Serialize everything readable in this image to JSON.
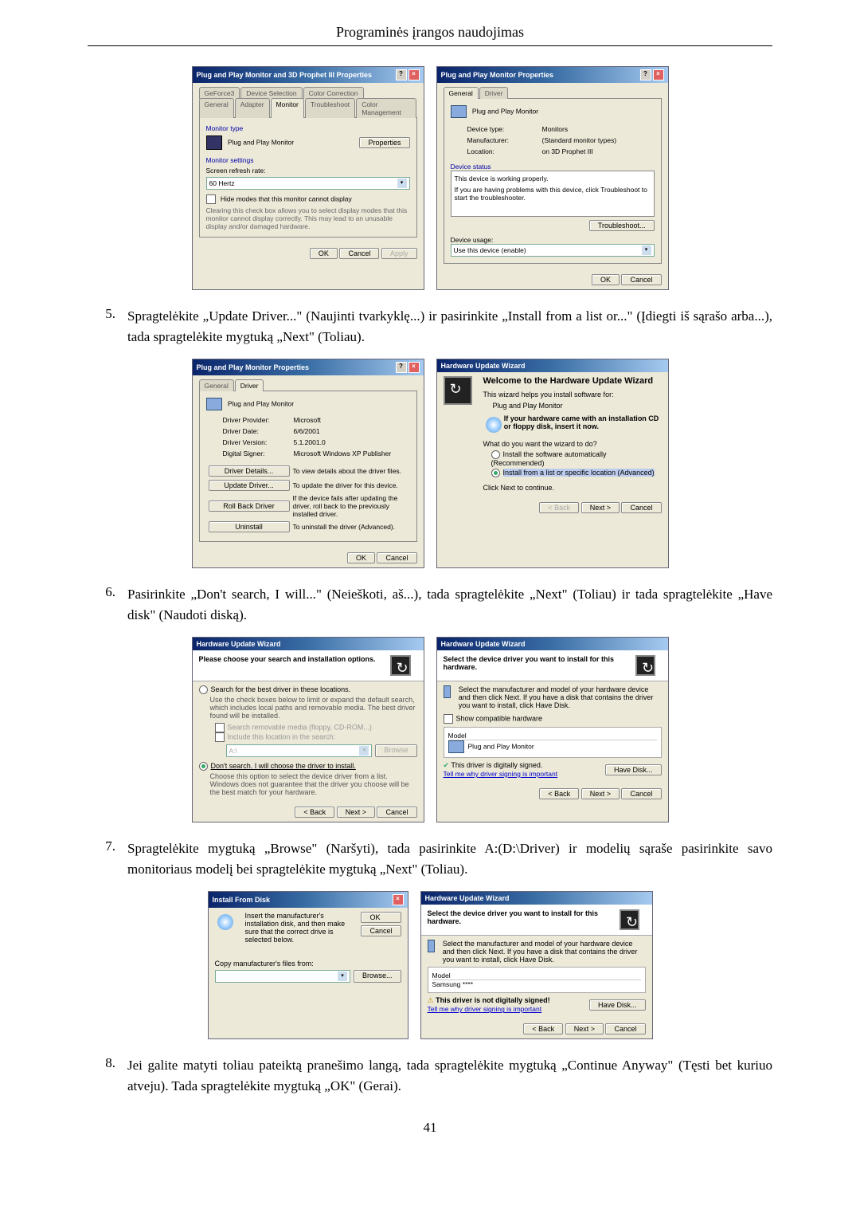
{
  "page_header": "Programinės įrangos naudojimas",
  "page_number": "41",
  "steps": {
    "5": {
      "num": "5.",
      "text": "Spragtelėkite „Update Driver...\" (Naujinti tvarkyklę...) ir pasirinkite „Install from a list or...\" (Įdiegti iš sąrašo arba...), tada spragtelėkite mygtuką „Next\" (Toliau)."
    },
    "6": {
      "num": "6.",
      "text": "Pasirinkite „Don't search, I will...\" (Neieškoti, aš...), tada spragtelėkite „Next\" (Toliau) ir tada spragtelėkite „Have disk\" (Naudoti diską)."
    },
    "7": {
      "num": "7.",
      "text": "Spragtelėkite mygtuką „Browse\" (Naršyti), tada pasirinkite A:(D:\\Driver) ir modelių sąraše pasirinkite savo monitoriaus modelį bei spragtelėkite mygtuką „Next\" (Toliau)."
    },
    "8": {
      "num": "8.",
      "text": "Jei galite matyti toliau pateiktą pranešimo langą, tada spragtelėkite mygtuką „Continue Anyway\" (Tęsti bet kuriuo atveju). Tada spragtelėkite mygtuką „OK\" (Gerai)."
    }
  },
  "dlg_prop1": {
    "title": "Plug and Play Monitor and 3D Prophet III Properties",
    "tabs": [
      "GeForce3",
      "Device Selection",
      "Color Correction",
      "General",
      "Adapter",
      "Monitor",
      "Troubleshoot",
      "Color Management"
    ],
    "monitor_type_label": "Monitor type",
    "monitor_name": "Plug and Play Monitor",
    "properties_btn": "Properties",
    "settings_label": "Monitor settings",
    "refresh_label": "Screen refresh rate:",
    "refresh_val": "60 Hertz",
    "hide_chk": "Hide modes that this monitor cannot display",
    "hide_desc": "Clearing this check box allows you to select display modes that this monitor cannot display correctly. This may lead to an unusable display and/or damaged hardware.",
    "ok": "OK",
    "cancel": "Cancel",
    "apply": "Apply"
  },
  "dlg_prop2": {
    "title": "Plug and Play Monitor Properties",
    "tabs": [
      "General",
      "Driver"
    ],
    "name": "Plug and Play Monitor",
    "type_l": "Device type:",
    "type_v": "Monitors",
    "manu_l": "Manufacturer:",
    "manu_v": "(Standard monitor types)",
    "loc_l": "Location:",
    "loc_v": "on 3D Prophet III",
    "status_l": "Device status",
    "status_t": "This device is working properly.",
    "status_d": "If you are having problems with this device, click Troubleshoot to start the troubleshooter.",
    "tshoot": "Troubleshoot...",
    "usage_l": "Device usage:",
    "usage_v": "Use this device (enable)",
    "ok": "OK",
    "cancel": "Cancel"
  },
  "dlg_drv": {
    "title": "Plug and Play Monitor Properties",
    "tabs": [
      "General",
      "Driver"
    ],
    "name": "Plug and Play Monitor",
    "prov_l": "Driver Provider:",
    "prov_v": "Microsoft",
    "date_l": "Driver Date:",
    "date_v": "6/6/2001",
    "ver_l": "Driver Version:",
    "ver_v": "5.1.2001.0",
    "sign_l": "Digital Signer:",
    "sign_v": "Microsoft Windows XP Publisher",
    "b1": "Driver Details...",
    "b1d": "To view details about the driver files.",
    "b2": "Update Driver...",
    "b2d": "To update the driver for this device.",
    "b3": "Roll Back Driver",
    "b3d": "If the device fails after updating the driver, roll back to the previously installed driver.",
    "b4": "Uninstall",
    "b4d": "To uninstall the driver (Advanced).",
    "ok": "OK",
    "cancel": "Cancel"
  },
  "dlg_hw1": {
    "title": "Hardware Update Wizard",
    "welcome": "Welcome to the Hardware Update Wizard",
    "helps": "This wizard helps you install software for:",
    "dev": "Plug and Play Monitor",
    "cd": "If your hardware came with an installation CD or floppy disk, insert it now.",
    "want": "What do you want the wizard to do?",
    "o1": "Install the software automatically (Recommended)",
    "o2": "Install from a list or specific location (Advanced)",
    "cont": "Click Next to continue.",
    "back": "< Back",
    "next": "Next >",
    "cancel": "Cancel"
  },
  "dlg_hw2": {
    "title": "Hardware Update Wizard",
    "head": "Please choose your search and installation options.",
    "o1": "Search for the best driver in these locations.",
    "o1d": "Use the check boxes below to limit or expand the default search, which includes local paths and removable media. The best driver found will be installed.",
    "c1": "Search removable media (floppy, CD-ROM...)",
    "c2": "Include this location in the search:",
    "path": "A:\\",
    "browse": "Browse",
    "o2": "Don't search. I will choose the driver to install.",
    "o2d": "Choose this option to select the device driver from a list. Windows does not guarantee that the driver you choose will be the best match for your hardware.",
    "back": "< Back",
    "next": "Next >",
    "cancel": "Cancel"
  },
  "dlg_hw3": {
    "title": "Hardware Update Wizard",
    "head": "Select the device driver you want to install for this hardware.",
    "desc": "Select the manufacturer and model of your hardware device and then click Next. If you have a disk that contains the driver you want to install, click Have Disk.",
    "compat": "Show compatible hardware",
    "model_l": "Model",
    "model_v": "Plug and Play Monitor",
    "signed": "This driver is digitally signed.",
    "tell": "Tell me why driver signing is important",
    "hd": "Have Disk...",
    "back": "< Back",
    "next": "Next >",
    "cancel": "Cancel"
  },
  "dlg_inst": {
    "title": "Install From Disk",
    "msg": "Insert the manufacturer's installation disk, and then make sure that the correct drive is selected below.",
    "ok": "OK",
    "cancel": "Cancel",
    "copy": "Copy manufacturer's files from:",
    "path": "",
    "browse": "Browse..."
  },
  "dlg_hw4": {
    "title": "Hardware Update Wizard",
    "head": "Select the device driver you want to install for this hardware.",
    "desc": "Select the manufacturer and model of your hardware device and then click Next. If you have a disk that contains the driver you want to install, click Have Disk.",
    "model_l": "Model",
    "model_v": "Samsung ****",
    "notsigned": "This driver is not digitally signed!",
    "tell": "Tell me why driver signing is important",
    "hd": "Have Disk...",
    "back": "< Back",
    "next": "Next >",
    "cancel": "Cancel"
  }
}
